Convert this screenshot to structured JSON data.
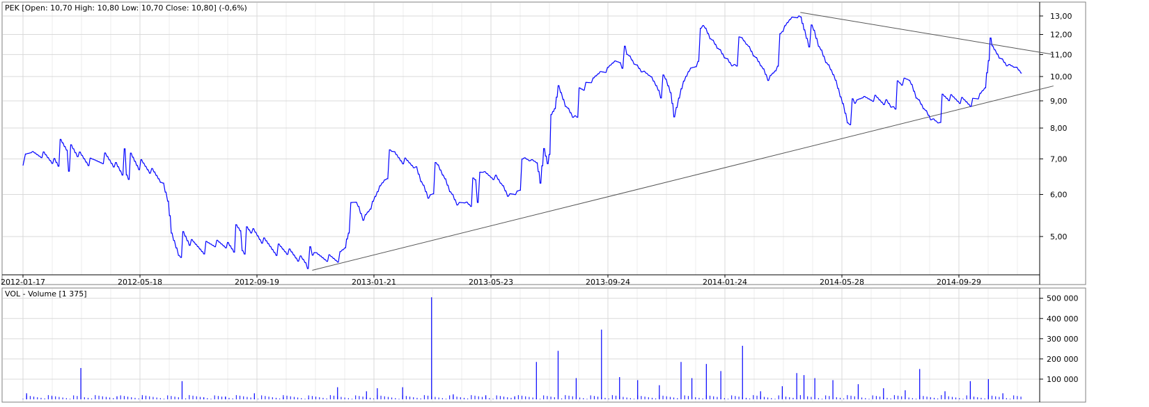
{
  "chart_data": [
    {
      "type": "line",
      "title": "PEK [Open: 10,70  High: 10,80  Low: 10,70  Close: 10,80] (-0,6%)",
      "y_scale": "log",
      "ylim": [
        4.3,
        13.6
      ],
      "yticks": [
        "13,00",
        "12,00",
        "11,00",
        "10,00",
        "9,00",
        "8,00",
        "7,00",
        "6,00",
        "5,00"
      ],
      "yvalues": [
        13,
        12,
        11,
        10,
        9,
        8,
        7,
        6,
        5
      ],
      "xticks": [
        "2012-01-17",
        "2012-05-18",
        "2012-09-19",
        "2013-01-21",
        "2013-05-23",
        "2013-09-24",
        "2014-01-24",
        "2014-05-28",
        "2014-09-29"
      ],
      "grid": true,
      "series": [
        {
          "color": "#0000ff",
          "points": [
            [
              0,
              6.8
            ],
            [
              2,
              7.1
            ],
            [
              5,
              7.3
            ],
            [
              8,
              7.3
            ],
            [
              12,
              7.1
            ],
            [
              15,
              6.9
            ],
            [
              18,
              6.8
            ],
            [
              22,
              7.2
            ],
            [
              25,
              7.1
            ],
            [
              28,
              6.9
            ],
            [
              32,
              6.6
            ],
            [
              35,
              6.5
            ],
            [
              38,
              6.4
            ],
            [
              40,
              5.9
            ],
            [
              41,
              5.2
            ],
            [
              43,
              4.9
            ],
            [
              46,
              4.7
            ],
            [
              50,
              4.75
            ],
            [
              53,
              4.9
            ],
            [
              56,
              5.0
            ],
            [
              60,
              4.95
            ],
            [
              63,
              4.9
            ],
            [
              66,
              4.8
            ],
            [
              70,
              4.78
            ],
            [
              73,
              4.8
            ],
            [
              76,
              4.78
            ],
            [
              78,
              4.75
            ],
            [
              80,
              4.4
            ],
            [
              81,
              4.5
            ],
            [
              84,
              4.6
            ],
            [
              87,
              4.7
            ],
            [
              89,
              5.0
            ],
            [
              90,
              5.4
            ],
            [
              92,
              5.6
            ],
            [
              94,
              5.3
            ],
            [
              96,
              5.7
            ],
            [
              98,
              6.3
            ],
            [
              100,
              6.8
            ],
            [
              102,
              6.9
            ],
            [
              105,
              6.85
            ],
            [
              108,
              6.9
            ],
            [
              110,
              6.5
            ],
            [
              112,
              6.2
            ],
            [
              114,
              6.5
            ],
            [
              116,
              6.3
            ],
            [
              118,
              6.0
            ],
            [
              120,
              5.8
            ],
            [
              122,
              6.0
            ],
            [
              125,
              6.1
            ],
            [
              127,
              6.3
            ],
            [
              130,
              6.4
            ],
            [
              132,
              6.3
            ],
            [
              134,
              6.1
            ],
            [
              136,
              6.3
            ],
            [
              138,
              6.6
            ],
            [
              140,
              6.7
            ],
            [
              142,
              6.8
            ],
            [
              143,
              6.3
            ],
            [
              144,
              7.5
            ],
            [
              145,
              7.2
            ],
            [
              146,
              8.0
            ],
            [
              147,
              8.4
            ],
            [
              148,
              9.5
            ],
            [
              150,
              9.0
            ],
            [
              152,
              8.8
            ],
            [
              155,
              9.1
            ],
            [
              157,
              9.4
            ],
            [
              159,
              10.0
            ],
            [
              161,
              10.3
            ],
            [
              163,
              11.0
            ],
            [
              165,
              11.3
            ],
            [
              167,
              10.5
            ],
            [
              169,
              10.3
            ],
            [
              171,
              10.2
            ],
            [
              173,
              10.3
            ],
            [
              175,
              10.1
            ],
            [
              177,
              9.5
            ],
            [
              179,
              9.0
            ],
            [
              180,
              8.2
            ],
            [
              182,
              9.6
            ],
            [
              184,
              10.6
            ],
            [
              186,
              11.1
            ],
            [
              188,
              11.9
            ],
            [
              190,
              11.5
            ],
            [
              192,
              11.3
            ],
            [
              194,
              11.1
            ],
            [
              196,
              11.0
            ],
            [
              198,
              11.2
            ],
            [
              200,
              11.1
            ],
            [
              202,
              10.8
            ],
            [
              204,
              10.6
            ],
            [
              206,
              10.2
            ],
            [
              208,
              10.9
            ],
            [
              210,
              11.6
            ],
            [
              212,
              12.5
            ],
            [
              214,
              12.9
            ],
            [
              215,
              13.1
            ],
            [
              216,
              12.7
            ],
            [
              218,
              11.8
            ],
            [
              220,
              11.0
            ],
            [
              222,
              10.5
            ],
            [
              224,
              10.2
            ],
            [
              226,
              9.5
            ],
            [
              228,
              8.7
            ],
            [
              230,
              8.5
            ],
            [
              232,
              8.9
            ],
            [
              235,
              9.2
            ],
            [
              238,
              9.3
            ],
            [
              240,
              9.2
            ],
            [
              243,
              9.3
            ],
            [
              245,
              9.5
            ],
            [
              247,
              9.0
            ],
            [
              249,
              8.8
            ],
            [
              251,
              8.6
            ],
            [
              253,
              8.7
            ],
            [
              256,
              8.8
            ],
            [
              259,
              8.9
            ],
            [
              262,
              9.0
            ],
            [
              264,
              9.3
            ],
            [
              266,
              10.0
            ],
            [
              267,
              11.4
            ],
            [
              268,
              10.9
            ],
            [
              270,
              10.7
            ],
            [
              272,
              10.6
            ],
            [
              274,
              10.8
            ],
            [
              276,
              10.8
            ]
          ]
        }
      ],
      "trendlines": [
        {
          "points": [
            [
              80,
              4.32
            ],
            [
              285,
              9.6
            ]
          ]
        },
        {
          "points": [
            [
              215,
              13.2
            ],
            [
              285,
              11.0
            ]
          ]
        }
      ]
    },
    {
      "type": "bar",
      "title": "VOL - Volume [1 375]",
      "ylim": [
        0,
        530000
      ],
      "yticks": [
        "500 000",
        "400 000",
        "300 000",
        "200 000",
        "100 000"
      ],
      "yvalues": [
        500000,
        400000,
        300000,
        200000,
        100000
      ],
      "color": "#0000ff",
      "bars": [
        [
          1,
          30000
        ],
        [
          8,
          12000
        ],
        [
          16,
          155000
        ],
        [
          26,
          15000
        ],
        [
          33,
          8000
        ],
        [
          44,
          90000
        ],
        [
          50,
          10000
        ],
        [
          56,
          14000
        ],
        [
          64,
          30000
        ],
        [
          72,
          10000
        ],
        [
          79,
          5000
        ],
        [
          87,
          60000
        ],
        [
          95,
          40000
        ],
        [
          98,
          55000
        ],
        [
          105,
          60000
        ],
        [
          113,
          505000
        ],
        [
          119,
          25000
        ],
        [
          128,
          20000
        ],
        [
          136,
          15000
        ],
        [
          142,
          185000
        ],
        [
          148,
          240000
        ],
        [
          153,
          105000
        ],
        [
          160,
          345000
        ],
        [
          165,
          110000
        ],
        [
          170,
          95000
        ],
        [
          176,
          70000
        ],
        [
          182,
          185000
        ],
        [
          185,
          105000
        ],
        [
          189,
          175000
        ],
        [
          193,
          140000
        ],
        [
          199,
          265000
        ],
        [
          204,
          40000
        ],
        [
          210,
          65000
        ],
        [
          214,
          130000
        ],
        [
          216,
          120000
        ],
        [
          219,
          105000
        ],
        [
          224,
          95000
        ],
        [
          231,
          75000
        ],
        [
          238,
          55000
        ],
        [
          244,
          45000
        ],
        [
          248,
          150000
        ],
        [
          255,
          40000
        ],
        [
          262,
          90000
        ],
        [
          267,
          100000
        ],
        [
          271,
          30000
        ]
      ]
    }
  ]
}
